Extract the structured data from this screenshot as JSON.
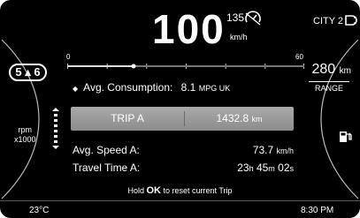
{
  "top": {
    "speed": "100",
    "speed_limit": "135",
    "speed_unit": "km/h",
    "limit_icon": "speed-limiter-icon",
    "drive_mode": "CITY 2",
    "mode_icon": "drive-mode-icon"
  },
  "left": {
    "gear": "5 ▴ 6",
    "rpm_label": "rpm",
    "rpm_scale": "x1000"
  },
  "right": {
    "range_value": "280",
    "range_unit": "km",
    "range_label": "RANGE",
    "fuel_icon": "fuel-pump-icon"
  },
  "consumption": {
    "scale_min": "0",
    "scale_max": "60",
    "level_fraction": 0.28,
    "bullet": "◆",
    "label": "Avg. Consumption:",
    "value": "8.1",
    "unit": "MPG UK"
  },
  "trip": {
    "name": "TRIP A",
    "distance": "1432.8",
    "distance_unit": "km"
  },
  "avg_speed": {
    "label": "Avg. Speed A:",
    "value": "73.7",
    "unit": "km/h"
  },
  "travel_time": {
    "label": "Travel Time A:",
    "hours": "23",
    "h": "h",
    "minutes": "45",
    "m": "m",
    "seconds": "02",
    "s": "s"
  },
  "hint": {
    "pre": "Hold",
    "key": "OK",
    "post": "to reset current Trip"
  },
  "footer": {
    "temperature": "23°C",
    "time": "8:30 PM"
  },
  "colors": {
    "background": "#000000",
    "text": "#ffffff",
    "trip_bar": "#9a9a9a"
  }
}
